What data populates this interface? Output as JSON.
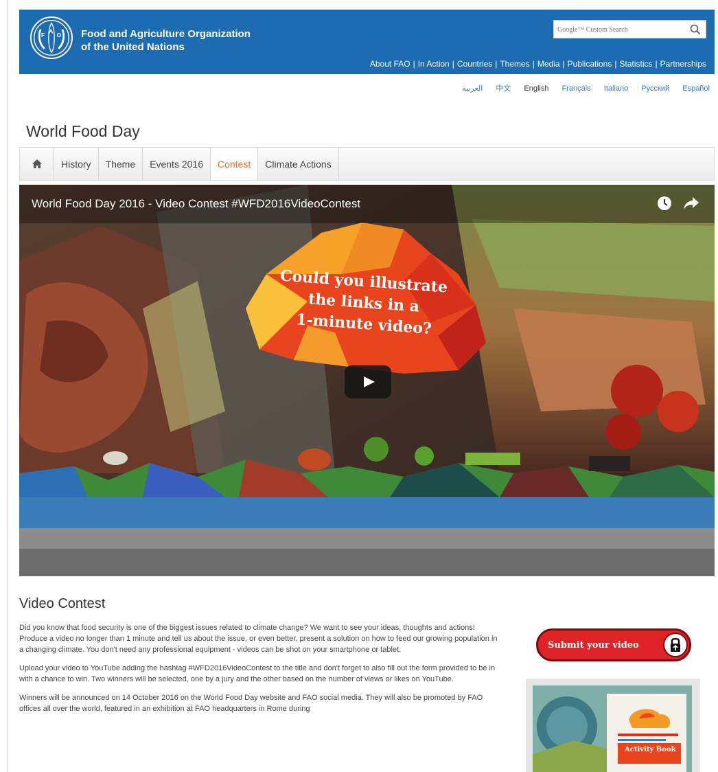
{
  "header": {
    "org_line1": "Food and Agriculture Organization",
    "org_line2": "of the United Nations",
    "search_placeholder": "Google™ Custom Search",
    "nav": [
      "About FAO",
      "In Action",
      "Countries",
      "Themes",
      "Media",
      "Publications",
      "Statistics",
      "Partnerships"
    ]
  },
  "languages": [
    "العربية",
    "中文",
    "English",
    "Français",
    "Italiano",
    "Русский",
    "Español"
  ],
  "active_language": "English",
  "page_title": "World Food Day",
  "tabs": [
    "History",
    "Theme",
    "Events 2016",
    "Contest",
    "Climate Actions"
  ],
  "active_tab": "Contest",
  "video": {
    "title": "World Food Day 2016 - Video Contest #WFD2016VideoContest",
    "bubble_line1": "Could you illustrate",
    "bubble_line2": "the links in a",
    "bubble_line3": "1-minute video?"
  },
  "section_title": "Video Contest",
  "paragraphs": [
    "Did you know that food security is one of the biggest issues related to climate change? We want to see your ideas, thoughts and actions! Produce a video no longer than 1 minute and tell us about the issue, or even better, present a solution on how to feed our growing population in a changing climate. You don't need any professional equipment - videos can be shot on your smartphone or tablet.",
    "Upload your video to YouTube adding the hashtag #WFD2016VideoContest to the title and don't forget to also fill out the form provided to be in with a chance to win. Two winners will be selected, one by a jury and the other based on the number of views or likes on YouTube.",
    "Winners will be announced on 14 October 2016 on the World Food Day website and FAO social media. They will also be promoted by FAO offices all over the world, featured in an exhibition at FAO headquarters in Rome during"
  ],
  "submit_label": "Submit your video",
  "activity_book_title": "Activity Book",
  "colors": {
    "header_blue": "#1d6bb0",
    "active_tab": "#e36b2b",
    "submit_red": "#e02326",
    "link_blue": "#3a7ab8"
  }
}
